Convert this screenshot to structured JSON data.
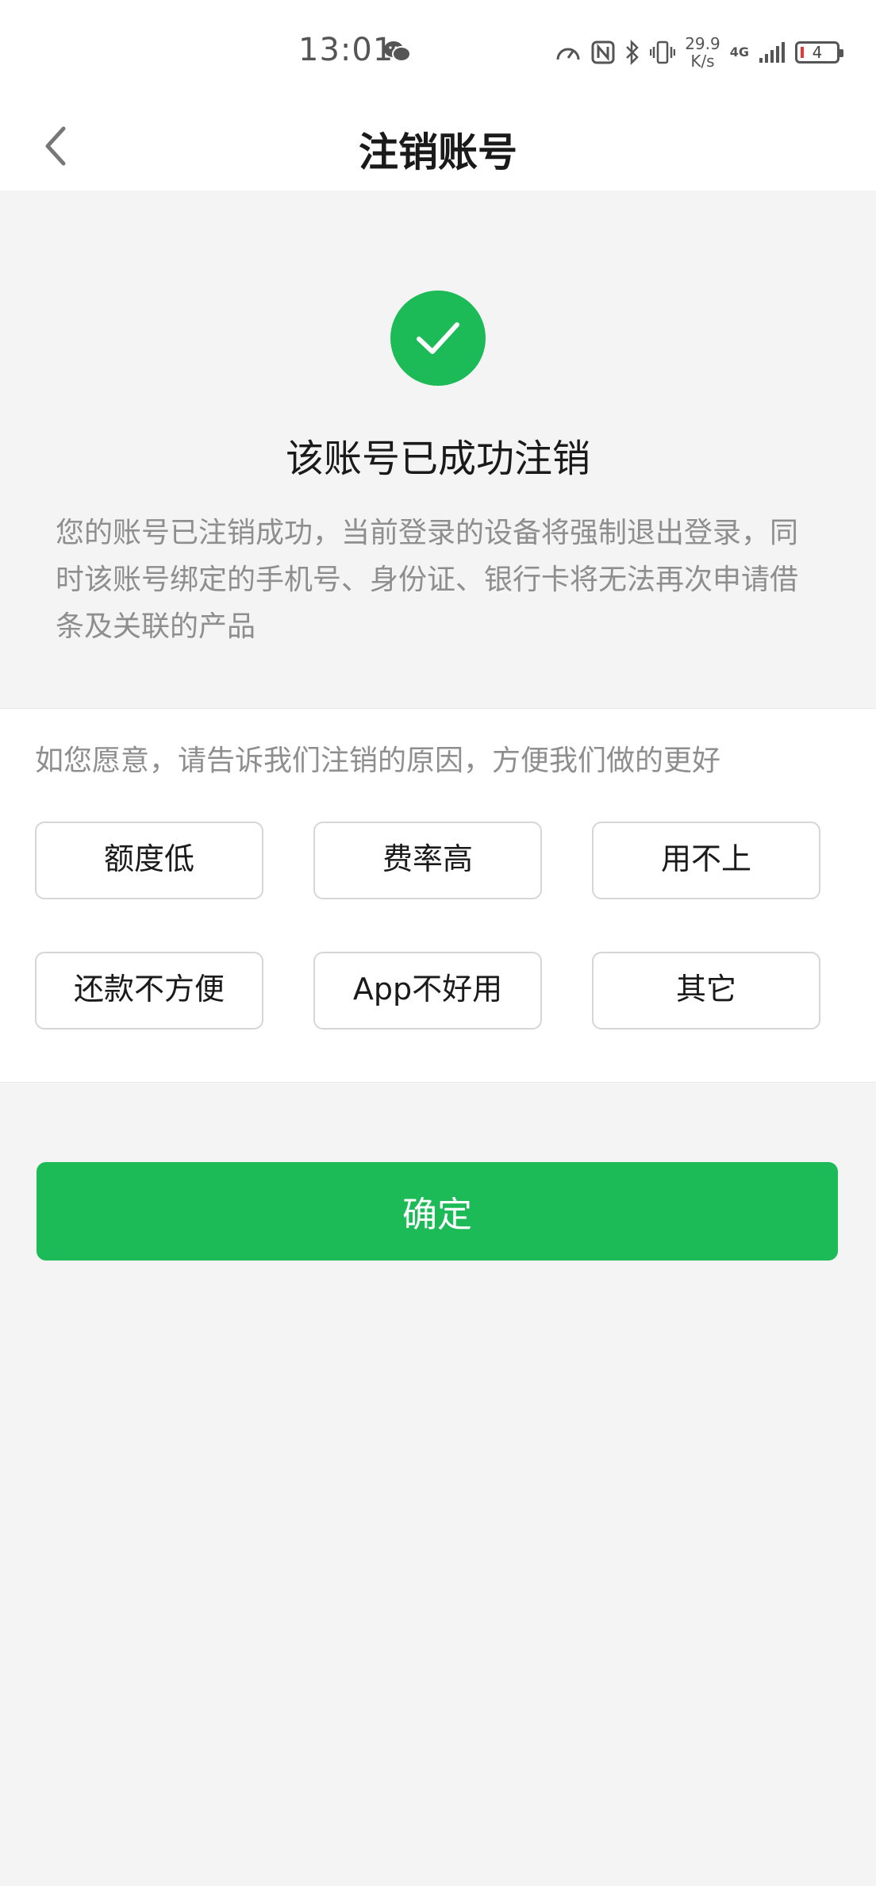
{
  "status_bar": {
    "time": "13:01",
    "net_speed_value": "29.9",
    "net_speed_unit": "K/s",
    "signal_type": "4G",
    "battery_level": "4",
    "icons": [
      "wechat-icon",
      "speedometer-icon",
      "nfc-icon",
      "bluetooth-icon",
      "vibrate-icon",
      "signal-icon",
      "battery-icon"
    ]
  },
  "nav": {
    "title": "注销账号",
    "back_icon": "chevron-left-icon"
  },
  "success": {
    "icon": "check-icon",
    "icon_color": "#1dba58",
    "title": "该账号已成功注销",
    "description": "您的账号已注销成功，当前登录的设备将强制退出登录，同时该账号绑定的手机号、身份证、银行卡将无法再次申请借条及关联的产品"
  },
  "reasons": {
    "prompt": "如您愿意，请告诉我们注销的原因，方便我们做的更好",
    "options": [
      "额度低",
      "费率高",
      "用不上",
      "还款不方便",
      "App不好用",
      "其它"
    ]
  },
  "confirm": {
    "label": "确定",
    "color": "#1dba58"
  }
}
